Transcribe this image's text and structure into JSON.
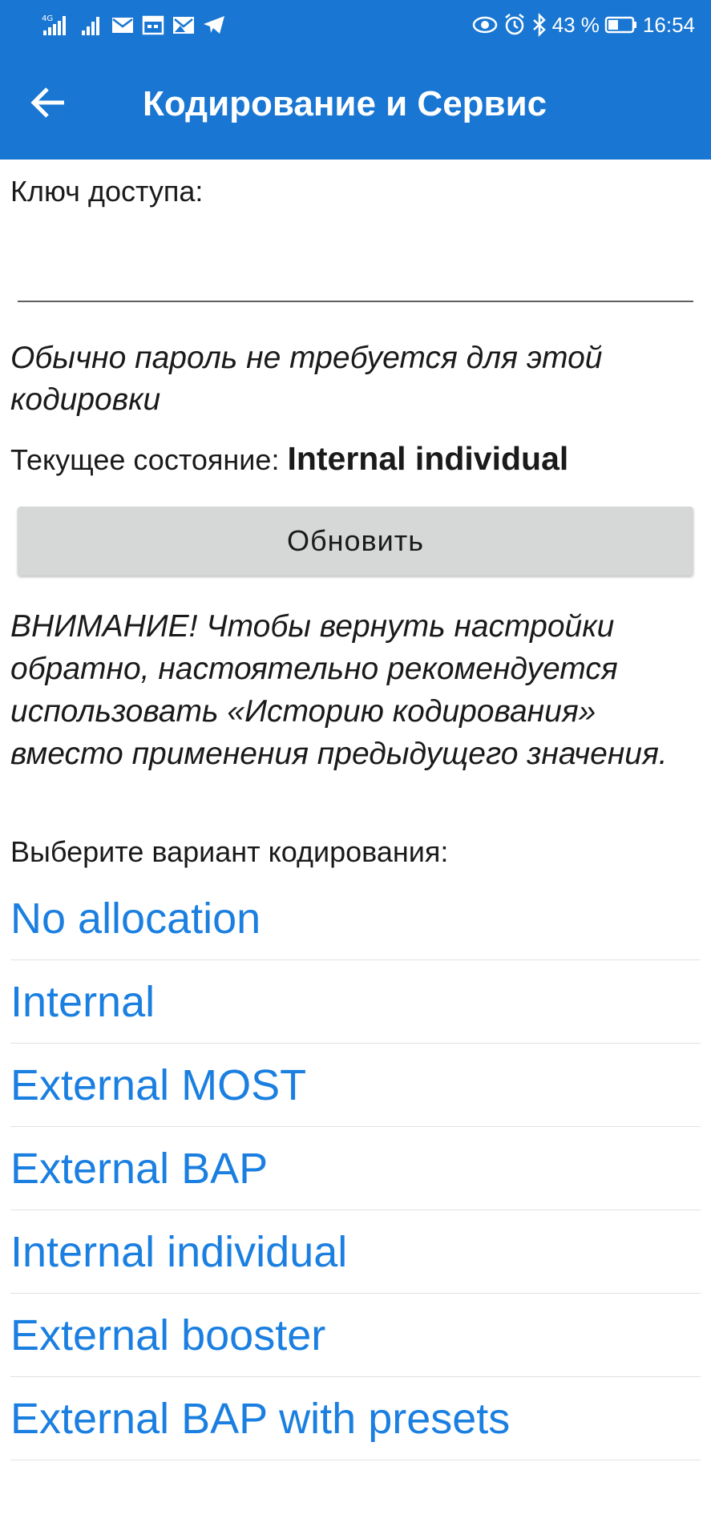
{
  "status_bar": {
    "network_type": "4G",
    "battery_percent": "43 %",
    "time": "16:54",
    "icons": [
      "signal-4g-icon",
      "signal-icon",
      "mail-icon",
      "calendar-icon",
      "image-mail-icon",
      "telegram-icon",
      "eye-icon",
      "alarm-icon",
      "bluetooth-icon",
      "battery-icon"
    ]
  },
  "app_bar": {
    "back_icon": "arrow-left-icon",
    "title": "Кодирование и Сервис"
  },
  "access_key": {
    "label": "Ключ доступа:",
    "value": "",
    "placeholder": ""
  },
  "password_note": "Обычно пароль не требуется для этой кодировки",
  "current_state": {
    "label": "Текущее состояние: ",
    "value": "Internal individual"
  },
  "refresh_button": "Обновить",
  "warning": "ВНИМАНИЕ! Чтобы вернуть настройки обратно, настоятельно рекомендуется использовать «Историю кодирования» вместо применения предыдущего значения.",
  "choose_label": "Выберите вариант кодирования:",
  "options": [
    {
      "label": "No allocation"
    },
    {
      "label": "Internal"
    },
    {
      "label": "External MOST"
    },
    {
      "label": "External BAP"
    },
    {
      "label": "Internal individual"
    },
    {
      "label": "External booster"
    },
    {
      "label": "External BAP with presets"
    }
  ],
  "colors": {
    "primary": "#1976d2",
    "option_text": "#1a7fe0",
    "button_bg": "#d6d7d7",
    "divider": "#e2e2e2"
  }
}
